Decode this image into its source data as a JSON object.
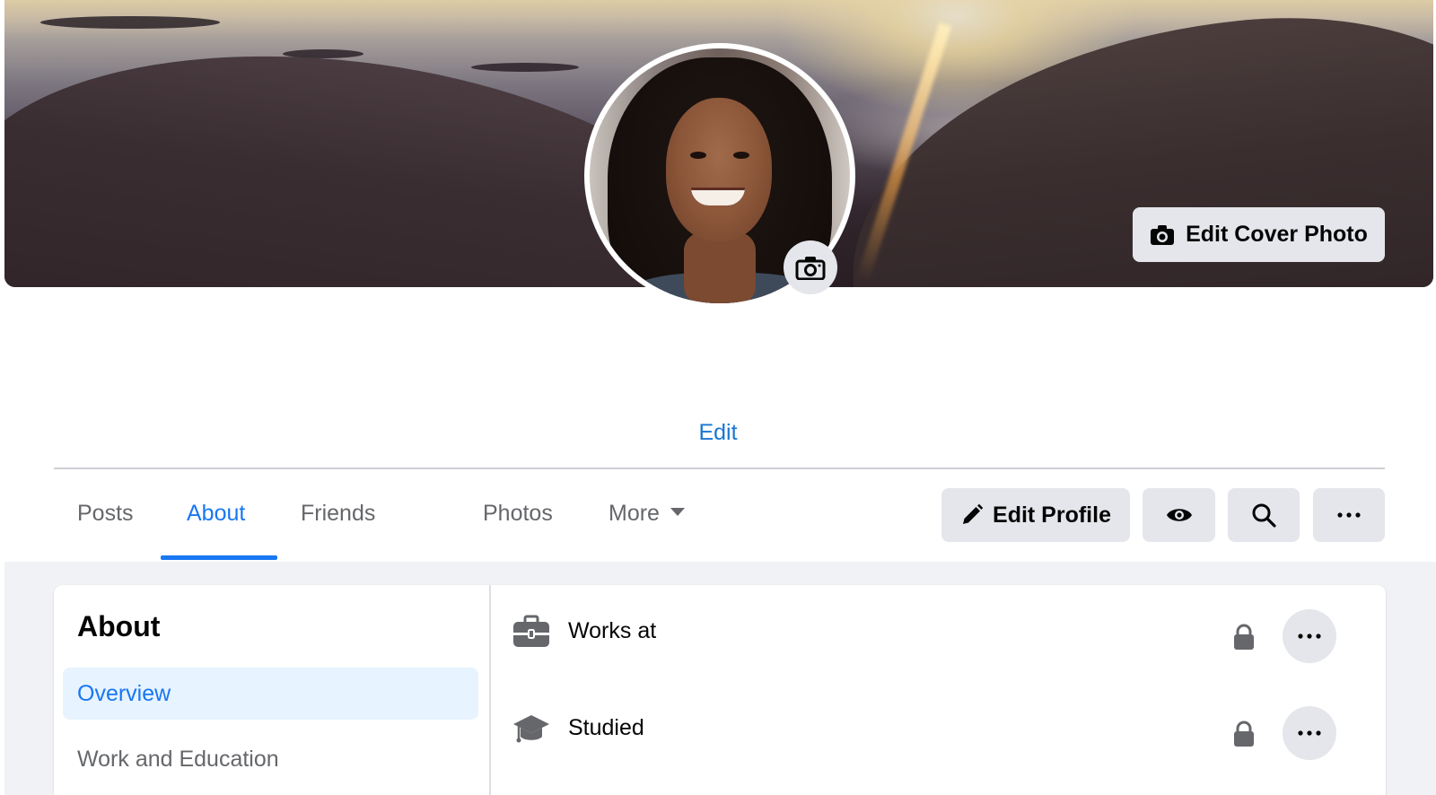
{
  "cover": {
    "edit_button_label": "Edit Cover Photo",
    "camera_icon": "camera-icon"
  },
  "profile": {
    "avatar_camera_icon": "camera-icon",
    "edit_link_label": "Edit"
  },
  "tabs": [
    {
      "label": "Posts",
      "active": false
    },
    {
      "label": "About",
      "active": true
    },
    {
      "label": "Friends",
      "active": false
    },
    {
      "label": "Photos",
      "active": false
    },
    {
      "label": "More",
      "active": false
    }
  ],
  "actions": {
    "edit_profile_label": "Edit Profile",
    "view_as_icon": "eye-icon",
    "search_icon": "search-icon",
    "more_icon": "ellipsis-icon"
  },
  "about": {
    "title": "About",
    "sidebar": [
      {
        "label": "Overview",
        "active": true
      },
      {
        "label": "Work and Education",
        "active": false
      }
    ],
    "rows": [
      {
        "icon": "briefcase-icon",
        "label": "Works at",
        "privacy_icon": "lock-icon"
      },
      {
        "icon": "graduation-cap-icon",
        "label": "Studied",
        "privacy_icon": "lock-icon"
      }
    ]
  },
  "colors": {
    "accent": "#1877f2",
    "button_bg": "#e4e6eb",
    "page_bg": "#f0f2f5",
    "muted_text": "#65676b"
  }
}
